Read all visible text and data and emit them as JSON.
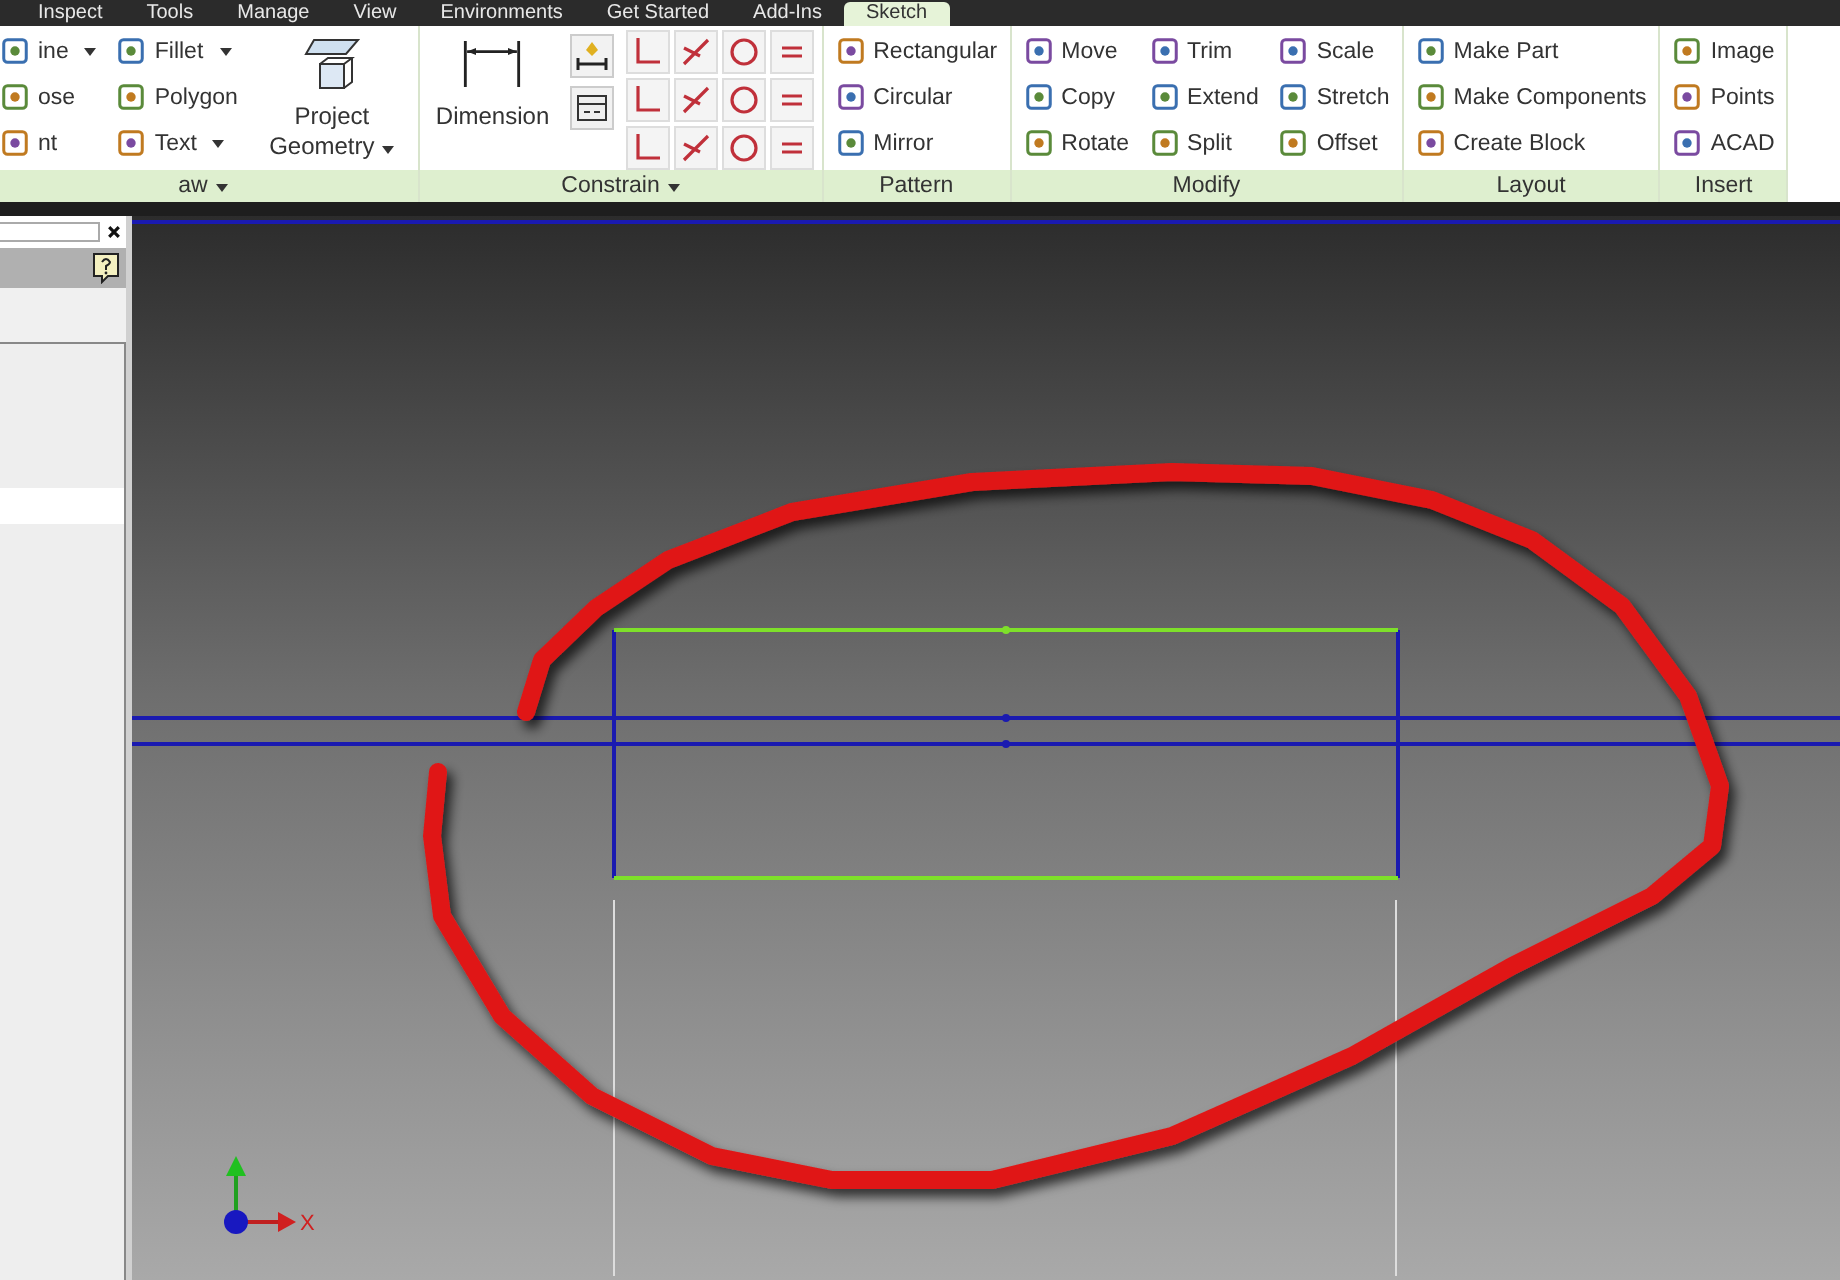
{
  "tabs": [
    {
      "label": "Inspect",
      "selected": false
    },
    {
      "label": "Tools",
      "selected": false
    },
    {
      "label": "Manage",
      "selected": false
    },
    {
      "label": "View",
      "selected": false
    },
    {
      "label": "Environments",
      "selected": false
    },
    {
      "label": "Get Started",
      "selected": false
    },
    {
      "label": "Add-Ins",
      "selected": false
    },
    {
      "label": "Sketch",
      "selected": true
    }
  ],
  "panels": [
    {
      "title": "aw",
      "has_menu": true,
      "kind": "tools",
      "columns": [
        [
          {
            "label": "ine",
            "has_menu": true
          },
          {
            "label": "ose",
            "has_menu": false
          },
          {
            "label": "nt",
            "has_menu": false
          }
        ],
        [
          {
            "label": "Fillet",
            "has_menu": true
          },
          {
            "label": "Polygon",
            "has_menu": false
          },
          {
            "label": "Text",
            "has_menu": true
          }
        ]
      ],
      "big": [
        {
          "label": "Project Geometry",
          "has_menu": true
        }
      ]
    },
    {
      "title": "Constrain",
      "has_menu": true,
      "kind": "constrain",
      "big": [
        {
          "label": "Dimension"
        }
      ]
    },
    {
      "title": "Pattern",
      "has_menu": false,
      "kind": "tools",
      "columns": [
        [
          {
            "label": "Rectangular",
            "has_menu": false
          },
          {
            "label": "Circular",
            "has_menu": false
          },
          {
            "label": "Mirror",
            "has_menu": false
          }
        ]
      ]
    },
    {
      "title": "Modify",
      "has_menu": false,
      "kind": "tools",
      "columns": [
        [
          {
            "label": "Move",
            "has_menu": false
          },
          {
            "label": "Copy",
            "has_menu": false
          },
          {
            "label": "Rotate",
            "has_menu": false
          }
        ],
        [
          {
            "label": "Trim",
            "has_menu": false
          },
          {
            "label": "Extend",
            "has_menu": false
          },
          {
            "label": "Split",
            "has_menu": false
          }
        ],
        [
          {
            "label": "Scale",
            "has_menu": false
          },
          {
            "label": "Stretch",
            "has_menu": false
          },
          {
            "label": "Offset",
            "has_menu": false
          }
        ]
      ]
    },
    {
      "title": "Layout",
      "has_menu": false,
      "kind": "tools",
      "columns": [
        [
          {
            "label": "Make Part",
            "has_menu": false
          },
          {
            "label": "Make Components",
            "has_menu": false
          },
          {
            "label": "Create Block",
            "has_menu": false
          }
        ]
      ]
    },
    {
      "title": "Insert",
      "has_menu": false,
      "kind": "tools",
      "columns": [
        [
          {
            "label": "Image",
            "has_menu": false
          },
          {
            "label": "Points",
            "has_menu": false
          },
          {
            "label": "ACAD",
            "has_menu": false
          }
        ]
      ]
    }
  ],
  "axis": {
    "x_label": "X"
  }
}
